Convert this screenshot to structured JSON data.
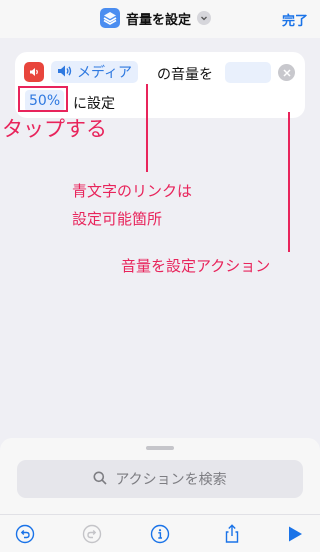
{
  "header": {
    "title": "音量を設定",
    "done_label": "完了"
  },
  "action": {
    "media_param": "メディア",
    "text_volume": "の音量を",
    "percent_param": "50%",
    "text_set": "に設定"
  },
  "annotations": {
    "tap": "タップする",
    "blue_text_line1": "青文字のリンクは",
    "blue_text_line2": "設定可能箇所",
    "action_name": "音量を設定アクション"
  },
  "search": {
    "placeholder": "アクションを検索"
  },
  "icons": {
    "header": [
      "shortcut-icon",
      "chevron-down-icon"
    ],
    "card": [
      "speaker-icon",
      "volume-icon",
      "clear-icon"
    ],
    "toolbar": [
      "undo-icon",
      "redo-icon",
      "info-icon",
      "share-icon",
      "play-icon"
    ]
  },
  "colors": {
    "accent": "#1a73e8",
    "annotation": "#e8245b",
    "speaker_badge": "#e8453c"
  }
}
